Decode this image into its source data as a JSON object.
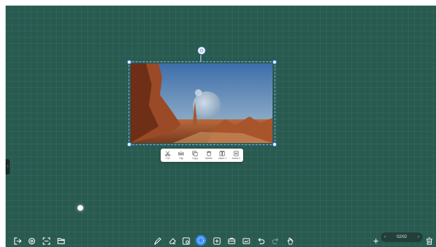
{
  "context_menu": {
    "items": [
      {
        "label": "Cut",
        "icon": "scissors-icon"
      },
      {
        "label": "Flip",
        "icon": "flip-icon"
      },
      {
        "label": "Copy",
        "icon": "copy-icon"
      },
      {
        "label": "Delete",
        "icon": "trash-icon"
      },
      {
        "label": "Insert 1",
        "icon": "layer-up-icon"
      },
      {
        "label": "Insert 2",
        "icon": "layer-down-icon"
      }
    ]
  },
  "toolbar_left": {
    "items": [
      "exit-icon",
      "settings-icon",
      "fullscreen-icon",
      "folder-icon"
    ]
  },
  "toolbar_center": {
    "items": [
      "pen-icon",
      "eraser-icon",
      "shape-icon",
      "select-icon",
      "insert-icon",
      "toolbox-icon",
      "image-icon",
      "undo-icon",
      "redo-icon",
      "hand-icon"
    ],
    "active": "select-icon"
  },
  "pager": {
    "add_label": "+",
    "prev_label": "‹",
    "page_text": "02/02",
    "next_label": "›"
  },
  "colors": {
    "board": "#285a50",
    "accent": "#3a8ef6"
  }
}
